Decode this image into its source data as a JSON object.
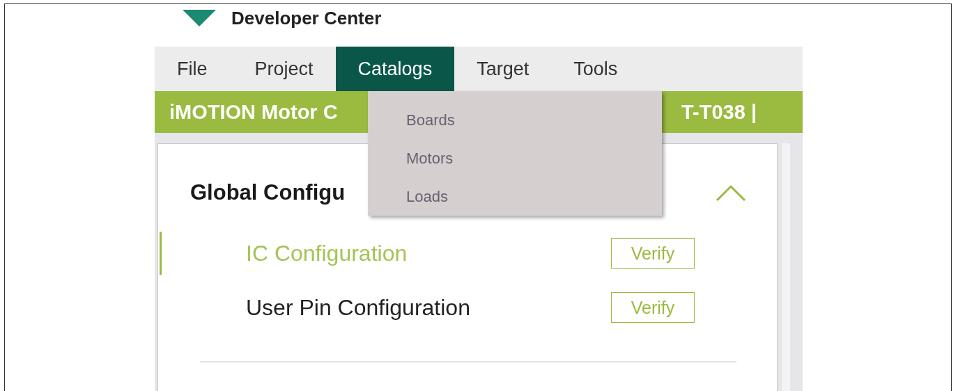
{
  "header": {
    "title": "Developer Center"
  },
  "menu": [
    {
      "label": "File",
      "selected": false
    },
    {
      "label": "Project",
      "selected": false
    },
    {
      "label": "Catalogs",
      "selected": true
    },
    {
      "label": "Target",
      "selected": false
    },
    {
      "label": "Tools",
      "selected": false
    }
  ],
  "dropdown": [
    "Boards",
    "Motors",
    "Loads"
  ],
  "banner": {
    "left_text": "iMOTION Motor C",
    "right_text": "T-T038 |"
  },
  "section": {
    "title": "Global Configu",
    "expanded": true,
    "items": [
      {
        "label": "IC Configuration",
        "selected": true,
        "button": "Verify"
      },
      {
        "label": "User Pin Configuration",
        "selected": false,
        "button": "Verify"
      }
    ]
  }
}
